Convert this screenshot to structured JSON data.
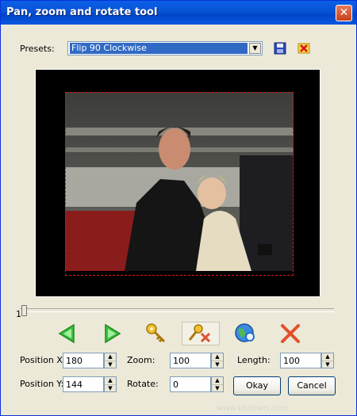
{
  "window": {
    "title": "Pan, zoom and rotate tool"
  },
  "presets": {
    "label": "Presets:",
    "selected": "Flip 90 Clockwise"
  },
  "icons": {
    "save": "floppy-save-icon",
    "delete": "delete-x-icon"
  },
  "slider": {
    "value": "1"
  },
  "toolbar": {
    "items": [
      "arrow-left-icon",
      "arrow-right-icon",
      "key-icon",
      "key-delete-icon",
      "globe-zoom-icon",
      "cancel-x-icon"
    ]
  },
  "fields": {
    "position_x_label": "Position X:",
    "position_x": "180",
    "position_y_label": "Position Y:",
    "position_y": "144",
    "zoom_label": "Zoom:",
    "zoom": "100",
    "rotate_label": "Rotate:",
    "rotate": "0",
    "length_label": "Length:",
    "length": "100"
  },
  "buttons": {
    "okay": "Okay",
    "cancel": "Cancel"
  },
  "colors": {
    "titlebar": "#0a5fe8",
    "accent_red": "#d11111",
    "selection": "#316ac5"
  },
  "watermark": "www.kkdown.com"
}
